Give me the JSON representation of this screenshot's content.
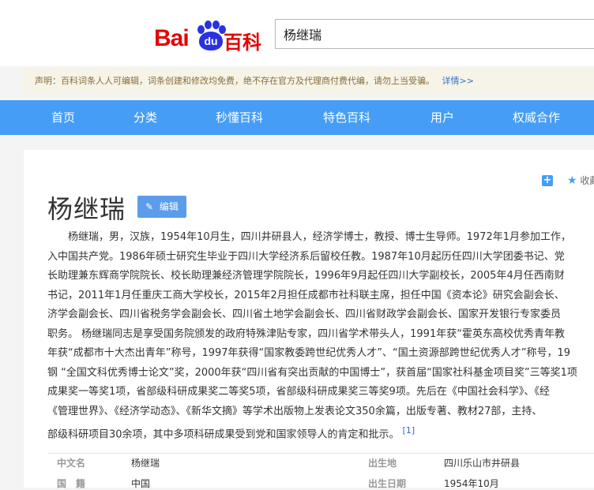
{
  "header": {
    "logo": {
      "bai": "Bai",
      "du": "du",
      "baike": "百科"
    },
    "search": {
      "value": "杨继瑞"
    }
  },
  "notice": {
    "text": "声明：百科词条人人可编辑，词条创建和修改均免费，绝不存在官方及代理商付费代编，请勿上当受骗。",
    "more": "详情>>"
  },
  "nav": {
    "items": [
      {
        "label": "首页"
      },
      {
        "label": "分类"
      },
      {
        "label": "秒懂百科"
      },
      {
        "label": "特色百科"
      },
      {
        "label": "用户"
      },
      {
        "label": "权威合作"
      }
    ]
  },
  "tools": {
    "plus": "+",
    "collect": "收藏"
  },
  "article": {
    "title": "杨继瑞",
    "edit_label": "编辑",
    "lines": [
      "杨继瑞，男，汉族，1954年10月生，四川井研县人，经济学博士，教授、博士生导师。1972年1月参加工作，",
      "入中国共产党。1986年硕士研究生毕业于四川大学经济系后留校任教。1987年10月起历任四川大学团委书记、党",
      "长助理兼东辉商学院院长、校长助理兼经济管理学院院长，1996年9月起任四川大学副校长，2005年4月任西南财",
      "书记，2011年1月任重庆工商大学校长，2015年2月担任成都市社科联主席，担任中国《资本论》研究会副会长、",
      "济学会副会长、四川省税务学会副会长、四川省土地学会副会长、四川省财政学会副会长、国家开发银行专家委员",
      "职务。 杨继瑞同志是享受国务院颁发的政府特殊津贴专家，四川省学术带头人，1991年获“霍英东高校优秀青年教",
      "年获“成都市十大杰出青年”称号，1997年获得“国家教委跨世纪优秀人才”、“国土资源部跨世纪优秀人才”称号，19",
      "钢 “全国文科优秀博士论文”奖，2000年获“四川省有突出贡献的中国博士”，获首届“国家社科基金项目奖”三等奖1项",
      "成果奖一等奖1项，省部级科研成果奖二等奖5项，省部级科研成果奖三等奖9项。先后在《中国社会科学》、《经",
      "《管理世界》、《经济学动态》、《新华文摘》等学术出版物上发表论文350余篇，出版专著、教材27部，主持、",
      "部级科研项目30余项，其中多项科研成果受到党和国家领导人的肯定和批示。"
    ],
    "citation": "[1]"
  },
  "info": {
    "rows": [
      {
        "label": "中文名",
        "value": "杨继瑞",
        "label2": "出生地",
        "value2": "四川乐山市井研县"
      },
      {
        "label": "国　籍",
        "value": "中国",
        "label2": "出生日期",
        "value2": "1954年10月"
      }
    ]
  }
}
